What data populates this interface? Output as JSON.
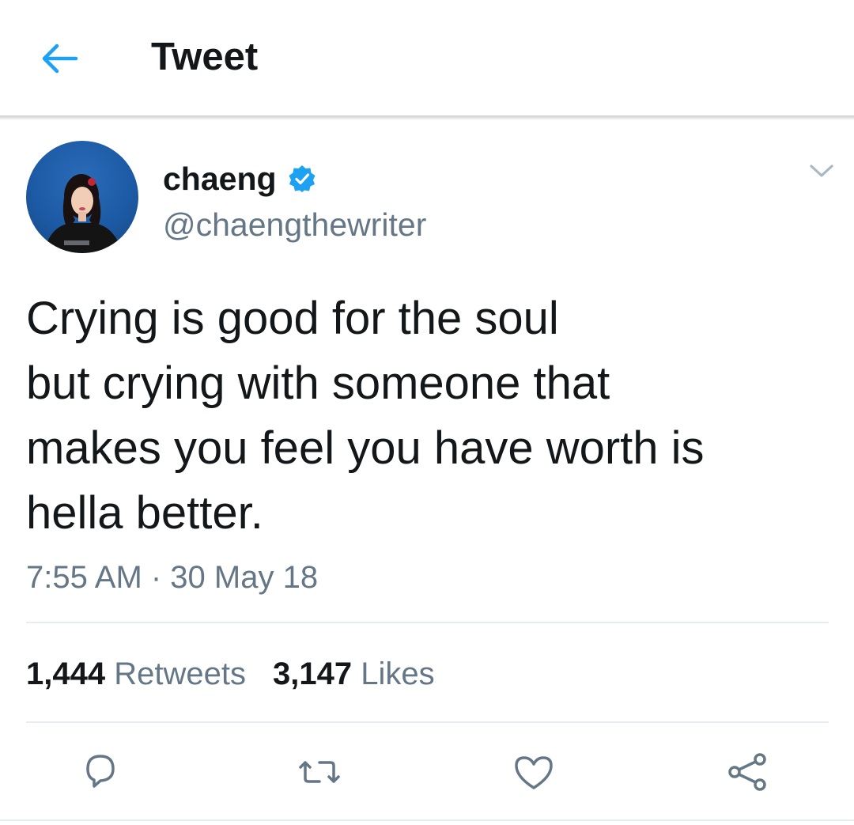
{
  "header": {
    "title": "Tweet",
    "back_icon": "arrow-left-icon",
    "accent": "#1da1f2"
  },
  "tweet": {
    "author": {
      "name": "chaeng",
      "handle": "@chaengthewriter",
      "verified": true,
      "avatar_icon": "avatar"
    },
    "text_lines": [
      "Crying is good for the soul",
      "but crying with someone that",
      "makes you feel you have worth is",
      "hella better."
    ],
    "timestamp": "7:55 AM · 30 May 18",
    "stats": {
      "retweets_count": "1,444",
      "retweets_label": "Retweets",
      "likes_count": "3,147",
      "likes_label": "Likes"
    },
    "actions": [
      "reply-icon",
      "retweet-icon",
      "like-icon",
      "share-icon"
    ]
  },
  "colors": {
    "text": "#14171a",
    "secondary": "#657786",
    "accent": "#1da1f2",
    "divider": "#e6ecf0"
  }
}
